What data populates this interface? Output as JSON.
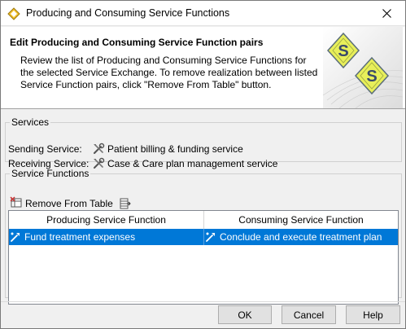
{
  "window": {
    "title": "Producing and Consuming Service Functions",
    "app_icon": "magicdraw-app-icon",
    "close_icon": "close-icon"
  },
  "header": {
    "title": "Edit Producing and Consuming Service Function pairs",
    "description": "Review the list of Producing and Consuming Service Functions for the selected Service Exchange. To remove realization between listed Service Function pairs, click \"Remove From Table\" button.",
    "logo_icon": "service-s-diamonds-logo"
  },
  "services": {
    "legend": "Services",
    "sending_label": "Sending Service:",
    "sending_value": "Patient billing & funding service",
    "receiving_label": "Receiving Service:",
    "receiving_value": "Case & Care plan management service",
    "service_icon": "tools-service-icon"
  },
  "functions": {
    "legend": "Service Functions",
    "remove_label": "Remove From Table",
    "remove_icon": "table-remove-icon",
    "export_icon": "table-export-icon",
    "columns": [
      "Producing Service Function",
      "Consuming Service Function"
    ],
    "rows": [
      {
        "producing": "Fund treatment expenses",
        "consuming": "Conclude and execute treatment plan",
        "selected": true
      }
    ],
    "row_icon": "service-function-icon"
  },
  "buttons": {
    "ok": "OK",
    "cancel": "Cancel",
    "help": "Help"
  },
  "colors": {
    "selection": "#0078d7",
    "logo_diamond": "#e8ef5a",
    "logo_s": "#3a4a6a"
  }
}
